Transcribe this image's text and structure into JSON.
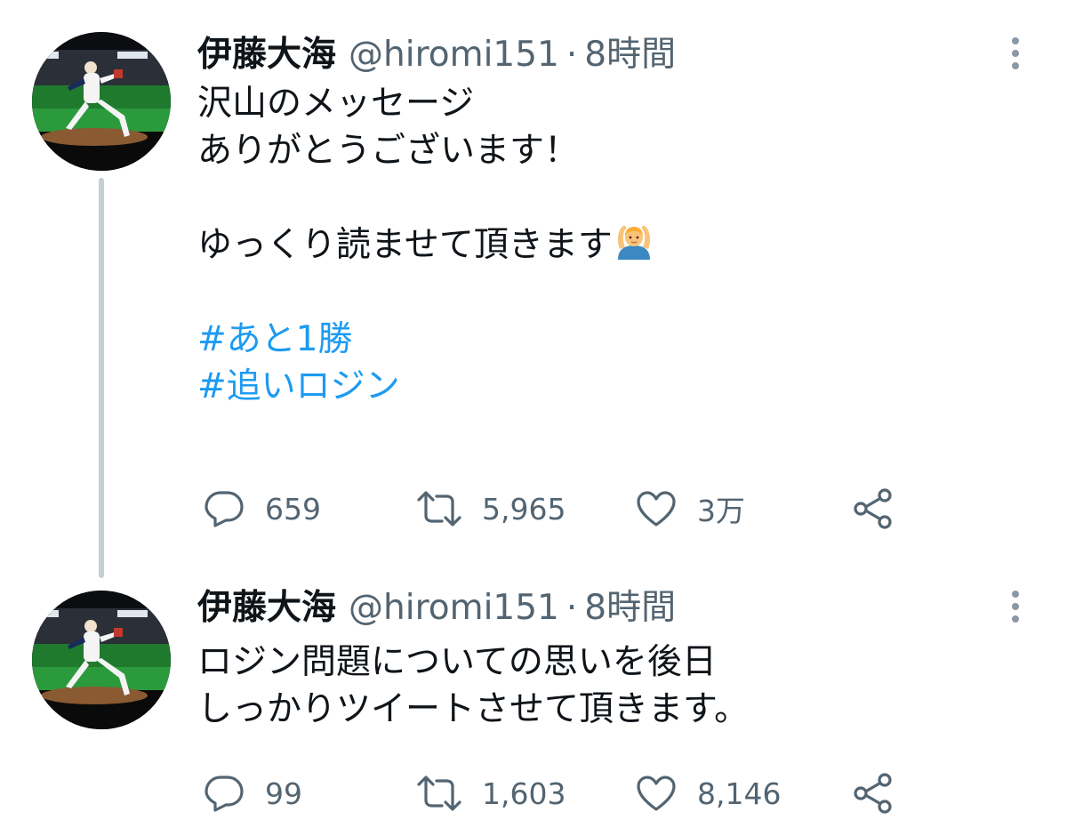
{
  "tweets": [
    {
      "author_name": "伊藤大海",
      "handle": "@hiromi151",
      "separator": "·",
      "time": "8時間",
      "lines": [
        "沢山のメッセージ",
        "ありがとうございます！",
        "",
        "ゆっくり読ませて頂きます",
        "",
        "#あと1勝",
        "#追いロジン"
      ],
      "emoji": "person-gesturing-ok-emoji",
      "replies": "659",
      "retweets": "5,965",
      "likes": "3万"
    },
    {
      "author_name": "伊藤大海",
      "handle": "@hiromi151",
      "separator": "·",
      "time": "8時間",
      "lines": [
        "ロジン問題についての思いを後日",
        "しっかりツイートさせて頂きます。"
      ],
      "replies": "99",
      "retweets": "1,603",
      "likes": "8,146"
    }
  ],
  "colors": {
    "text": "#0f1419",
    "secondary": "#536471",
    "hashtag": "#1d9bf0",
    "thread_line": "#c4cfd6"
  },
  "icons": {
    "reply": "reply-icon",
    "retweet": "retweet-icon",
    "like": "heart-icon",
    "share": "share-icon",
    "more": "more-vertical-icon"
  }
}
